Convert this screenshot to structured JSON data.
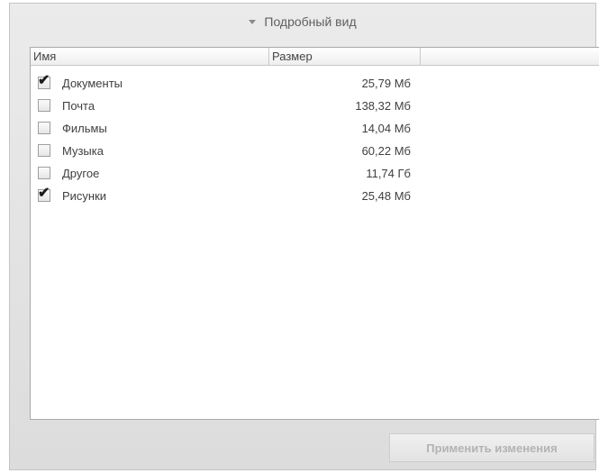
{
  "header": {
    "title": "Подробный вид",
    "toggle_icon": "triangle-down-icon"
  },
  "list": {
    "columns": [
      "Имя",
      "Размер",
      ""
    ],
    "rows": [
      {
        "name": "Документы",
        "size": "25,79 Мб",
        "checked": true
      },
      {
        "name": "Почта",
        "size": "138,32 Мб",
        "checked": false
      },
      {
        "name": "Фильмы",
        "size": "14,04 Мб",
        "checked": false
      },
      {
        "name": "Музыка",
        "size": "60,22 Мб",
        "checked": false
      },
      {
        "name": "Другое",
        "size": "11,74 Гб",
        "checked": false
      },
      {
        "name": "Рисунки",
        "size": "25,48 Мб",
        "checked": true
      }
    ]
  },
  "footer": {
    "apply_label": "Применить изменения",
    "apply_enabled": false
  }
}
